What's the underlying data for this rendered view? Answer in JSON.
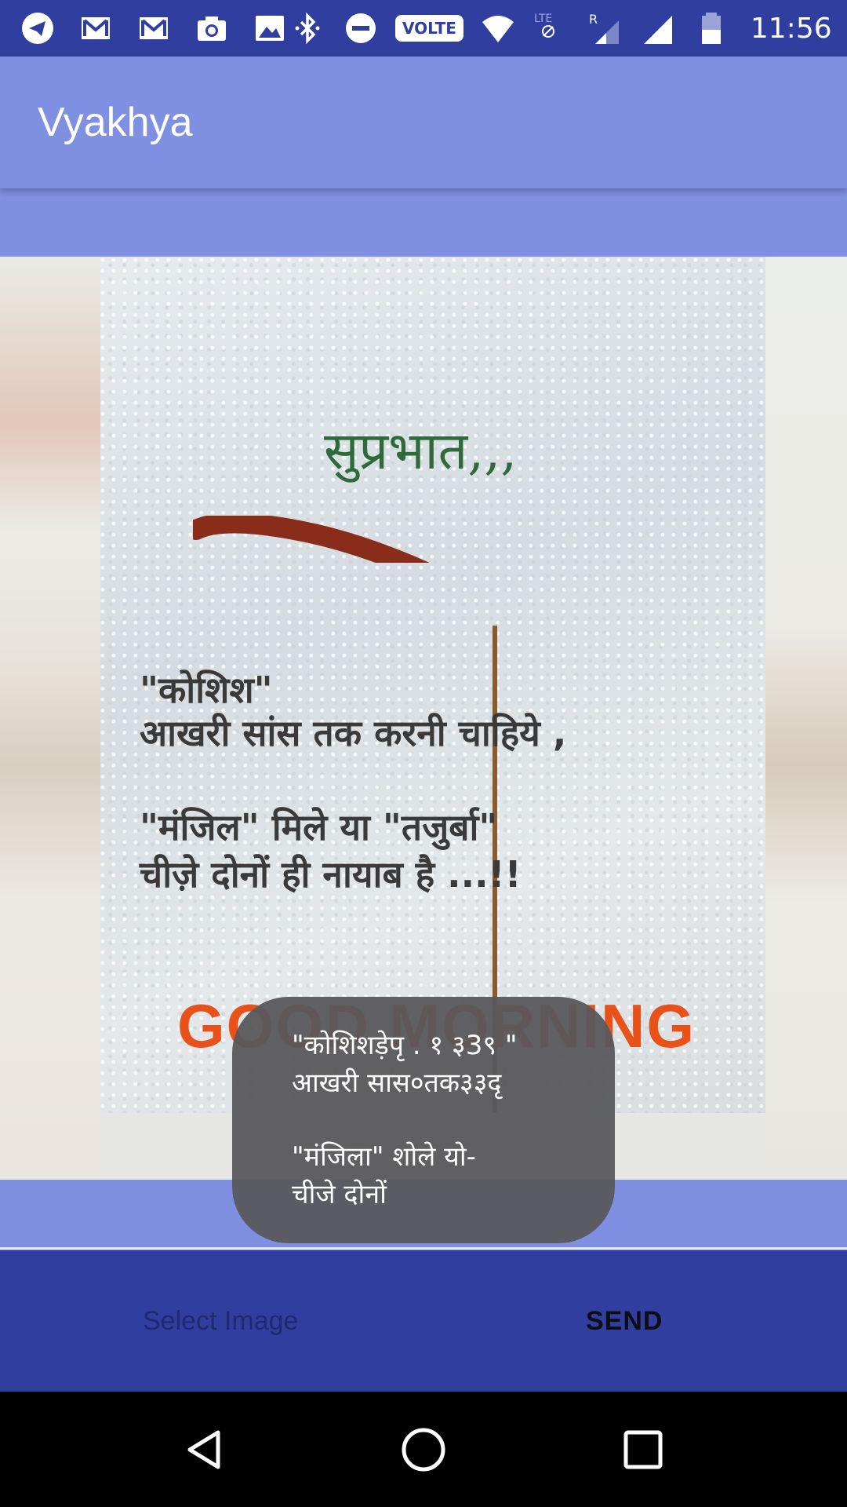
{
  "status_bar": {
    "time": "11:56",
    "volte_label": "VOLTE",
    "icons": [
      "telegram-icon",
      "gmail-icon",
      "gmail-icon",
      "camera-icon",
      "gallery-icon",
      "bluetooth-icon",
      "do-not-disturb-icon",
      "volte-icon",
      "wifi-icon",
      "lte-signal-icon",
      "roaming-signal-icon",
      "signal-icon",
      "battery-icon"
    ]
  },
  "app_bar": {
    "title": "Vyakhya"
  },
  "image": {
    "heading": "सुप्रभात,,,",
    "line1": "\"कोशिश\"",
    "line2": "आखरी सांस तक करनी चाहिये ,",
    "line3": "\"मंजिल\" मिले या \"तजुर्बा\"",
    "line4": "चीज़े दोनों ही नायाब है ...!!",
    "footer": "GOOD MORNING"
  },
  "buttons": {
    "select_image": "Select Image",
    "send": "SEND"
  },
  "toast": {
    "line1": "\"कोशिशड़ेपृ . १ ३3९ \"",
    "line2": "आखरी सास०तक३३दृ",
    "line3": "\"मंजिला\" शोले यो-",
    "line4": "चीजे दोनों"
  },
  "nav": [
    "back-icon",
    "home-icon",
    "recents-icon"
  ],
  "colors": {
    "status_bar": "#303f9f",
    "app_bar": "#7f90e3",
    "button_bar": "#303f9f",
    "nav_bar": "#000000"
  }
}
